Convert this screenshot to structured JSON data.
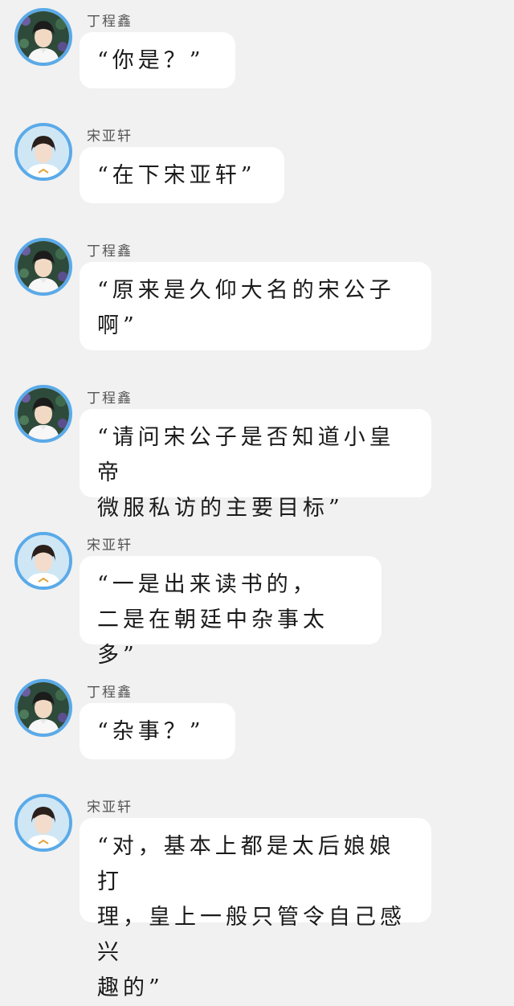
{
  "messages": [
    {
      "sender": "丁程鑫",
      "avatar_icon": "user-avatar-icon",
      "text": "“你是？”"
    },
    {
      "sender": "宋亚轩",
      "avatar_icon": "user-avatar-icon",
      "text": "“在下宋亚轩”"
    },
    {
      "sender": "丁程鑫",
      "avatar_icon": "user-avatar-icon",
      "text": "“原来是久仰大名的宋公子\n啊”"
    },
    {
      "sender": "丁程鑫",
      "avatar_icon": "user-avatar-icon",
      "text": "“请问宋公子是否知道小皇帝\n微服私访的主要目标”"
    },
    {
      "sender": "宋亚轩",
      "avatar_icon": "user-avatar-icon",
      "text": "“一是出来读书的，\n二是在朝廷中杂事太多”"
    },
    {
      "sender": "丁程鑫",
      "avatar_icon": "user-avatar-icon",
      "text": "“杂事？”"
    },
    {
      "sender": "宋亚轩",
      "avatar_icon": "user-avatar-icon",
      "text": "“对，基本上都是太后娘娘打\n理，皇上一般只管令自己感兴\n趣的”"
    }
  ],
  "colors": {
    "background": "#f1f1f1",
    "bubble": "#ffffff",
    "avatar_ring": "#5aaae8",
    "text": "#1a1a1a",
    "sender_text": "#555555"
  }
}
